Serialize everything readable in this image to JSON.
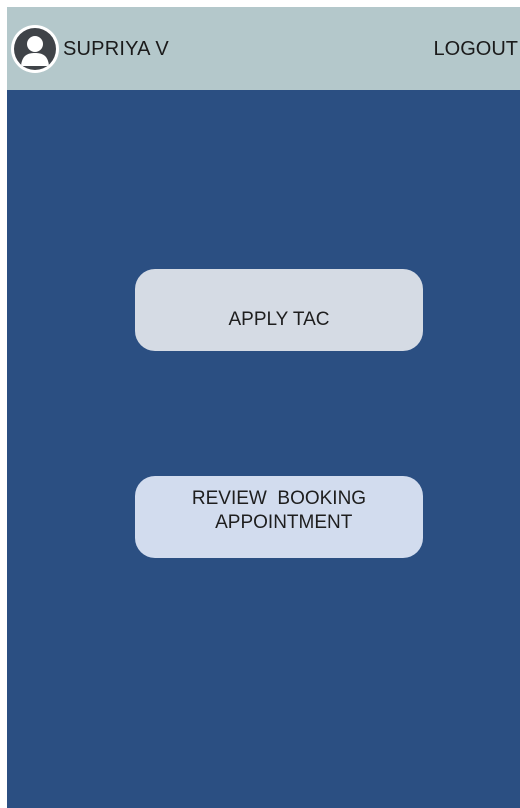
{
  "header": {
    "user_name": "SUPRIYA V",
    "logout_label": "LOGOUT"
  },
  "main": {
    "apply_tac_label": "APPLY TAC",
    "review_booking_label": "REVIEW  BOOKING\n  APPOINTMENT"
  },
  "colors": {
    "header_background": "#b4c8cb",
    "body_background": "#2b4f82",
    "button_apply": "#d5dbe4",
    "button_review": "#d2dcee"
  },
  "icons": {
    "avatar": "user-avatar-icon"
  }
}
